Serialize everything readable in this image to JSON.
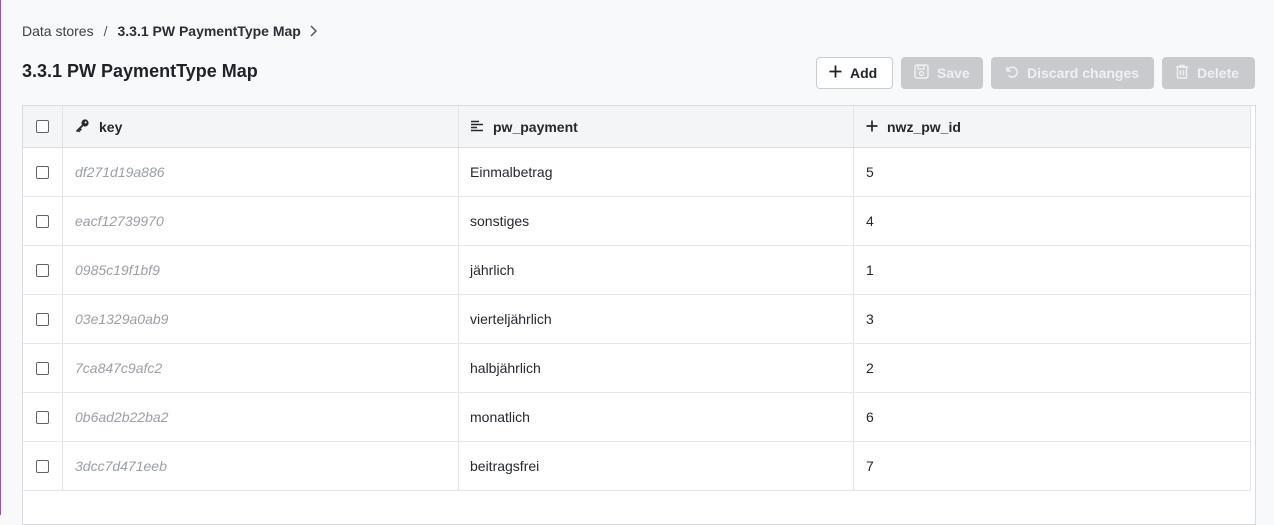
{
  "breadcrumb": {
    "root": "Data stores",
    "separator": "/",
    "current": "3.3.1 PW PaymentType Map"
  },
  "title": "3.3.1 PW PaymentType Map",
  "toolbar": {
    "add_label": "Add",
    "save_label": "Save",
    "discard_label": "Discard changes",
    "delete_label": "Delete"
  },
  "table": {
    "columns": [
      {
        "label": "key",
        "icon": "key-icon"
      },
      {
        "label": "pw_payment",
        "icon": "text-align-icon"
      },
      {
        "label": "nwz_pw_id",
        "icon": "plus-icon"
      }
    ],
    "rows": [
      {
        "key": "df271d19a886",
        "pw_payment": "Einmalbetrag",
        "nwz_pw_id": "5"
      },
      {
        "key": "eacf12739970",
        "pw_payment": "sonstiges",
        "nwz_pw_id": "4"
      },
      {
        "key": "0985c19f1bf9",
        "pw_payment": "jährlich",
        "nwz_pw_id": "1"
      },
      {
        "key": "03e1329a0ab9",
        "pw_payment": "vierteljährlich",
        "nwz_pw_id": "3"
      },
      {
        "key": "7ca847c9afc2",
        "pw_payment": "halbjährlich",
        "nwz_pw_id": "2"
      },
      {
        "key": "0b6ad2b22ba2",
        "pw_payment": "monatlich",
        "nwz_pw_id": "6"
      },
      {
        "key": "3dcc7d471eeb",
        "pw_payment": "beitragsfrei",
        "nwz_pw_id": "7"
      }
    ]
  },
  "colors": {
    "accent_frame": "#b040c8",
    "disabled_button": "#c8cacd"
  }
}
